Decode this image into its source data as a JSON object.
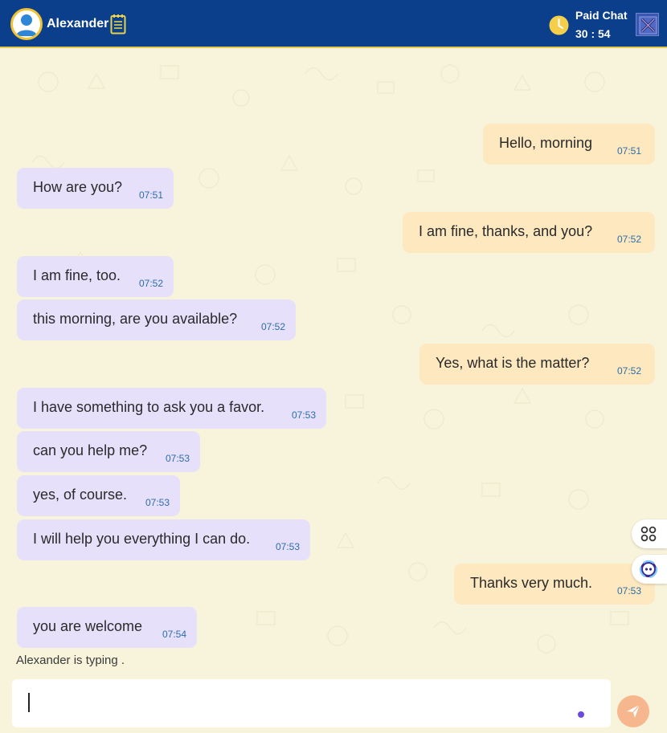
{
  "header": {
    "name": "Alexander",
    "paid_label": "Paid Chat",
    "timer": "30 : 54",
    "avatar_icon": "user-icon",
    "notes_icon": "notepad-icon",
    "timer_icon": "clock-icon",
    "close_icon": "close-icon",
    "colors": {
      "bar": "#0b3f8c",
      "accent": "#f1c232"
    }
  },
  "messages": [
    {
      "direction": "out",
      "text": "Hello, morning",
      "time": "07:51"
    },
    {
      "direction": "in",
      "text": "How are you?",
      "time": "07:51"
    },
    {
      "direction": "out",
      "text": "I am fine, thanks, and you?",
      "time": "07:52"
    },
    {
      "direction": "in",
      "text": "I am fine, too.",
      "time": "07:52"
    },
    {
      "direction": "in",
      "text": "this morning, are you available?",
      "time": "07:52"
    },
    {
      "direction": "out",
      "text": "Yes, what is the matter?",
      "time": "07:52"
    },
    {
      "direction": "in",
      "text": "I have something to ask you a favor.",
      "time": "07:53"
    },
    {
      "direction": "in",
      "text": "can you help me?",
      "time": "07:53"
    },
    {
      "direction": "in",
      "text": "yes, of course.",
      "time": "07:53"
    },
    {
      "direction": "in",
      "text": "I will help you everything I can do.",
      "time": "07:53"
    },
    {
      "direction": "out",
      "text": "Thanks very much.",
      "time": "07:53"
    },
    {
      "direction": "in",
      "text": "you are welcome",
      "time": "07:54"
    }
  ],
  "typing_indicator": "Alexander is typing .",
  "side_buttons": [
    {
      "icon": "apps-grid-icon"
    },
    {
      "icon": "assistant-face-icon"
    }
  ],
  "composer": {
    "value": "",
    "send_icon": "send-icon"
  },
  "colors": {
    "incoming_bubble": "#e6e0fb",
    "outgoing_bubble": "#fde8c0",
    "timestamp": "#2d6ea8",
    "send_button": "#f7b78e"
  }
}
